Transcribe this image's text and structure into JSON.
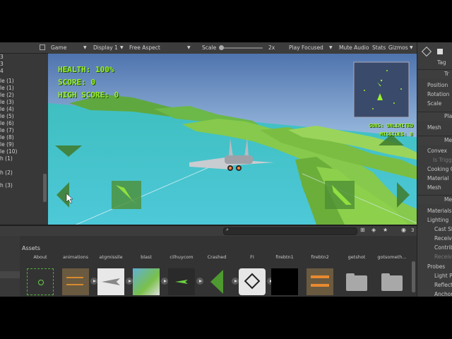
{
  "hierarchy": {
    "rows": [
      "3",
      "3",
      "4",
      "le (1)",
      "le (1)",
      "le (2)",
      "le (3)",
      "le (4)",
      "le (5)",
      "le (6)",
      "le (7)",
      "le (8)",
      "le (9)",
      "le (10)",
      "h (1)",
      "h (2)",
      "h (3)"
    ]
  },
  "gameToolbar": {
    "tab": "Game",
    "display": "Display 1",
    "aspect": "Free Aspect",
    "scale_label": "Scale",
    "scale_value": "2x",
    "play_mode": "Play Focused",
    "mute": "Mute Audio",
    "stats": "Stats",
    "gizmos": "Gizmos"
  },
  "hud": {
    "health": "HEALTH: 100%",
    "score": "SCORE: 0",
    "high_score": "HIGH SCORE: 0",
    "guns": "GUNS: UNLIMITED",
    "missiles": "MISSILES: 8",
    "hud_color": "#9bf02e"
  },
  "inspector": {
    "tag_label": "Tag",
    "transform_title": "Tr",
    "position": "Position",
    "rotation": "Rotation",
    "scale": "Scale",
    "mesh_filter_title": "Pla",
    "mesh": "Mesh",
    "collider_title": "Me",
    "convex": "Convex",
    "is_trigger": "Is Trigg",
    "cooking": "Cooking C",
    "material": "Material",
    "mesh2": "Mesh",
    "renderer_title": "Me",
    "materials": "Materials",
    "lighting": "Lighting",
    "cast_shadows": "Cast Sh",
    "receive_shadows": "Receiv",
    "contribute_gi": "Contrib",
    "receive_gi": "Receiv",
    "probes": "Probes",
    "light_probes": "Light P",
    "reflection_probes": "Reflect",
    "anchor": "Anchor"
  },
  "project": {
    "title": "Assets",
    "hidden_count": "3",
    "assets": [
      {
        "name": "About",
        "icon": "crosshair-sprite-icon"
      },
      {
        "name": "animations",
        "icon": "animation-sprite-icon"
      },
      {
        "name": "atgmissile",
        "icon": "jet-sprite-icon"
      },
      {
        "name": "blast",
        "icon": "terrain-sprite-icon"
      },
      {
        "name": "cilhuycom",
        "icon": "plane-sprite-icon"
      },
      {
        "name": "Crashed",
        "icon": "arrow-sprite-icon"
      },
      {
        "name": "FI",
        "icon": "unity-asset-icon"
      },
      {
        "name": "firebtn1",
        "icon": "black-sprite-icon"
      },
      {
        "name": "firebtn2",
        "icon": "fire-sprite-icon"
      },
      {
        "name": "getshot",
        "icon": "folder-icon"
      },
      {
        "name": "gotsometh...",
        "icon": "folder-icon"
      }
    ]
  }
}
